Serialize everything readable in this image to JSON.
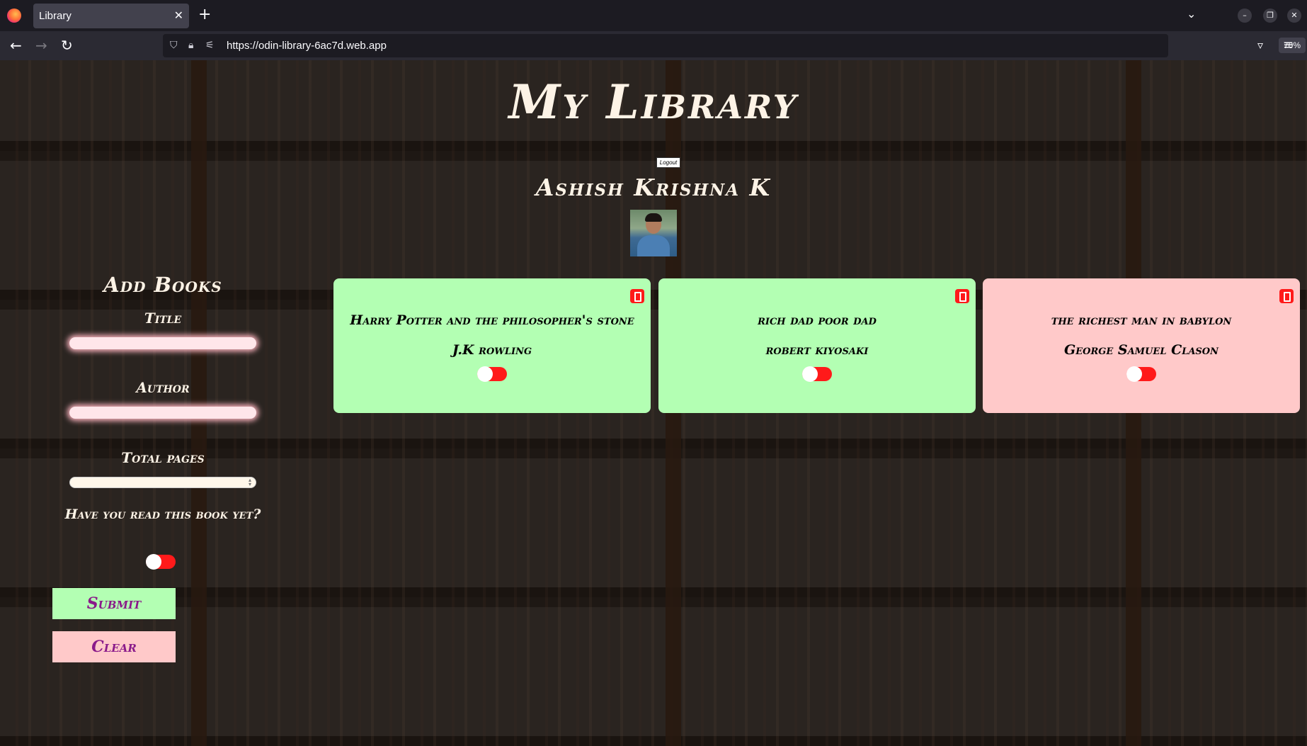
{
  "browser": {
    "tab_title": "Library",
    "tab_close": "✕",
    "new_tab": "+",
    "url_full": "https://odin-library-6ac7d.web.app",
    "zoom": "70%"
  },
  "header": {
    "title": "My Library",
    "logout_label": "Logout",
    "user_name": "Ashish Krishna K"
  },
  "form": {
    "heading": "Add Books",
    "title_label": "Title",
    "author_label": "Author",
    "pages_label": "Total pages",
    "read_label": "Have you read this book yet?",
    "read_value": false,
    "submit_label": "Submit",
    "clear_label": "Clear"
  },
  "books": [
    {
      "title": "Harry Potter and the philosopher's stone",
      "author": "J.K rowling",
      "read": false,
      "card_color": "#b3ffb3"
    },
    {
      "title": "rich dad poor dad",
      "author": "robert kiyosaki",
      "read": false,
      "card_color": "#b3ffb3"
    },
    {
      "title": "the richest man in babylon",
      "author": "George Samuel Clason",
      "read": false,
      "card_color": "#ffc9c9"
    }
  ],
  "colors": {
    "read_card": "#b3ffb3",
    "unread_card": "#ffc9c9",
    "toggle_off": "#ff1a1a",
    "delete_button": "#ff1a1a",
    "button_text": "#8a1a8a"
  },
  "icons": {
    "firefox": "firefox-logo",
    "back": "arrow-left-icon",
    "forward": "arrow-right-icon",
    "reload": "reload-icon",
    "shield": "shield-icon",
    "lock": "lock-icon",
    "permissions": "permissions-icon",
    "bookmark": "star-icon",
    "pocket": "pocket-icon",
    "menu": "hamburger-menu-icon",
    "delete": "trash-icon"
  }
}
